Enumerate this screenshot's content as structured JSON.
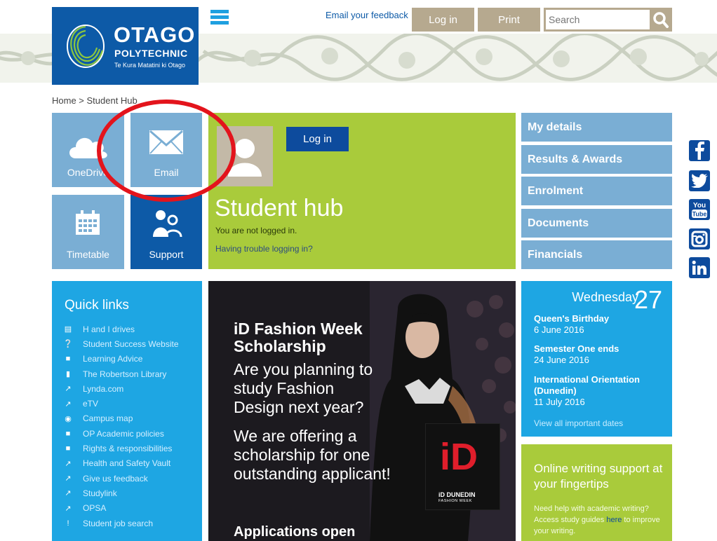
{
  "logo": {
    "name": "OTAGO",
    "sub": "POLYTECHNIC",
    "tagline": "Te Kura Matatini ki Otago",
    "color": "#0d5aa7"
  },
  "header": {
    "feedback": "Email your feedback",
    "login": "Log in",
    "print": "Print",
    "search_placeholder": "Search"
  },
  "breadcrumb": "Home > Student Hub",
  "tiles": {
    "onedrive": "OneDrive",
    "email": "Email",
    "timetable": "Timetable",
    "support": "Support"
  },
  "hub": {
    "login": "Log in",
    "title": "Student hub",
    "status": "You are not logged in.",
    "trouble": "Having trouble logging in?"
  },
  "side_nav": [
    "My details",
    "Results & Awards",
    "Enrolment",
    "Documents",
    "Financials"
  ],
  "social": [
    "facebook",
    "twitter",
    "youtube",
    "instagram",
    "linkedin"
  ],
  "quick_links": {
    "title": "Quick links",
    "items": [
      {
        "icon": "drive-icon",
        "label": "H and I drives"
      },
      {
        "icon": "help-icon",
        "label": "Student Success Website"
      },
      {
        "icon": "folder-icon",
        "label": "Learning Advice"
      },
      {
        "icon": "book-icon",
        "label": "The Robertson Library"
      },
      {
        "icon": "external-link-icon",
        "label": "Lynda.com"
      },
      {
        "icon": "external-link-icon",
        "label": "eTV"
      },
      {
        "icon": "globe-icon",
        "label": "Campus map"
      },
      {
        "icon": "folder-icon",
        "label": "OP Academic policies"
      },
      {
        "icon": "folder-icon",
        "label": "Rights & responsibilities"
      },
      {
        "icon": "external-link-icon",
        "label": "Health and Safety Vault"
      },
      {
        "icon": "external-link-icon",
        "label": "Give us feedback"
      },
      {
        "icon": "external-link-icon",
        "label": "Studylink"
      },
      {
        "icon": "external-link-icon",
        "label": "OPSA"
      },
      {
        "icon": "exclamation-icon",
        "label": "Student job search"
      }
    ]
  },
  "hero": {
    "title": "iD Fashion Week Scholarship",
    "body1": "Are you planning to study Fashion Design next year?",
    "body2": "We are offering a scholarship for one outstanding applicant!",
    "apply": "Applications open",
    "card_big": "iD",
    "card_sub1": "iD DUNEDIN",
    "card_sub2": "FASHION WEEK"
  },
  "dates": {
    "day": "Wednesday",
    "num": "27",
    "events": [
      {
        "title": "Queen's Birthday",
        "date": "6 June 2016"
      },
      {
        "title": "Semester One ends",
        "date": "24 June 2016"
      },
      {
        "title": "International Orientation (Dunedin)",
        "date": "11 July 2016"
      }
    ],
    "more": "View all important dates"
  },
  "writing": {
    "title": "Online writing support at your fingertips",
    "text_pre": "Need help with academic writing? Access study guides ",
    "link": "here",
    "text_post": " to improve your writing."
  },
  "colors": {
    "blue": "#0d5aa7",
    "light_blue": "#7aaed4",
    "cyan": "#1ea6e3",
    "green": "#a9cb3b",
    "tan": "#b6a98f",
    "highlight": "#e3141c"
  }
}
